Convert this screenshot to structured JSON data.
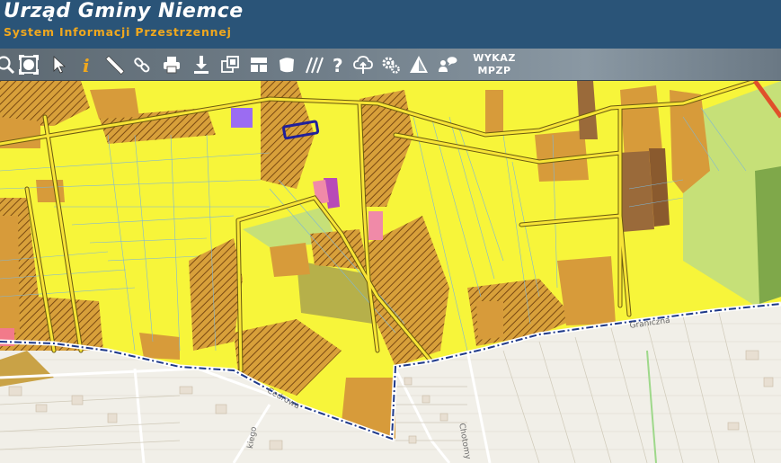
{
  "header": {
    "title": "Urząd Gminy Niemce",
    "subtitle": "System Informacji Przestrzennej"
  },
  "toolbar": {
    "tools": [
      {
        "name": "zoom-icon"
      },
      {
        "name": "zoom-extent-icon"
      },
      {
        "name": "select-arrow-icon"
      },
      {
        "name": "info-icon"
      },
      {
        "name": "measure-ruler-icon"
      },
      {
        "name": "link-icon"
      },
      {
        "name": "print-icon"
      },
      {
        "name": "download-icon"
      },
      {
        "name": "layers-copy-icon"
      },
      {
        "name": "layout-icon"
      },
      {
        "name": "shape-icon"
      },
      {
        "name": "hatch-icon"
      },
      {
        "name": "help-icon"
      },
      {
        "name": "cloud-upload-icon"
      },
      {
        "name": "settings-icon"
      },
      {
        "name": "warning-triangle-icon"
      },
      {
        "name": "users-chat-icon"
      }
    ],
    "wykaz_line1": "WYKAZ",
    "wykaz_line2": "MPZP"
  },
  "map": {
    "street_labels": [
      {
        "text": "Graniczna"
      },
      {
        "text": "Cedrowa"
      },
      {
        "text": "Chotomy"
      },
      {
        "text": "kiego"
      }
    ],
    "colors": {
      "residential_yellow": "#f7f53a",
      "service_orange": "#d79b3a",
      "hatched": "#c98a2c",
      "brown": "#9a6a3a",
      "green": "#c6e078",
      "purple": "#9b6cf2",
      "pink": "#f08aa8",
      "outline_blue": "#20209a",
      "boundary": "#1f3a8a",
      "base": "#f2f0ea"
    }
  }
}
